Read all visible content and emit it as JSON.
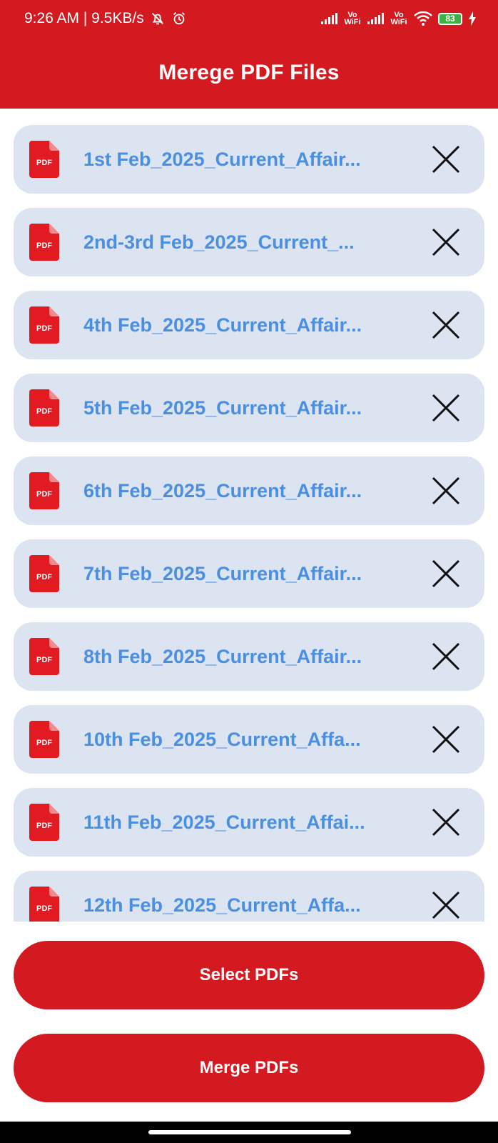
{
  "status_bar": {
    "time_speed": "9:26 AM | 9.5KB/s",
    "vowifi_1": "Vo WiFi",
    "vowifi_2": "Vo WiFi",
    "battery": "83",
    "icons": [
      "alarm-off-icon",
      "alarm-clock-icon",
      "signal-icon",
      "wifi-icon",
      "battery-icon",
      "charging-icon"
    ]
  },
  "app_bar": {
    "title": "Merege PDF Files"
  },
  "files": [
    {
      "name": "1st Feb_2025_Current_Affair..."
    },
    {
      "name": "2nd-3rd Feb_2025_Current_..."
    },
    {
      "name": "4th Feb_2025_Current_Affair..."
    },
    {
      "name": "5th Feb_2025_Current_Affair..."
    },
    {
      "name": "6th Feb_2025_Current_Affair..."
    },
    {
      "name": "7th Feb_2025_Current_Affair..."
    },
    {
      "name": "8th Feb_2025_Current_Affair..."
    },
    {
      "name": "10th Feb_2025_Current_Affa..."
    },
    {
      "name": "11th Feb_2025_Current_Affai..."
    },
    {
      "name": "12th Feb_2025_Current_Affa..."
    }
  ],
  "pdf_icon_label": "PDF",
  "buttons": {
    "select": "Select PDFs",
    "merge": "Merge PDFs"
  },
  "colors": {
    "primary": "#d21a20",
    "item_bg": "#dce3f1",
    "file_text": "#4a8fe0"
  }
}
